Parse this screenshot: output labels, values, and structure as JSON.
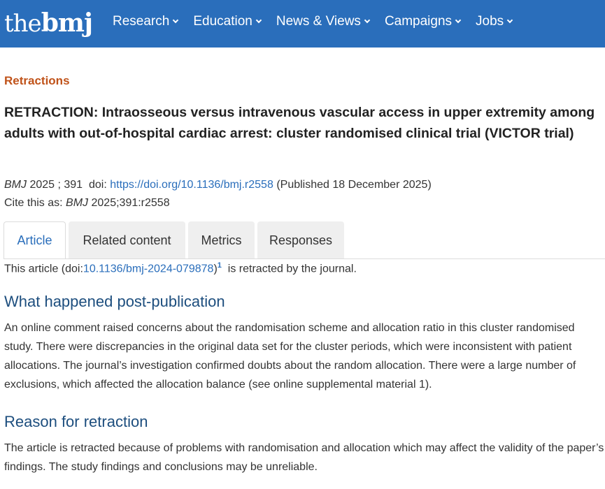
{
  "header": {
    "logo_the": "the",
    "logo_bmj": "bmj",
    "nav": [
      "Research",
      "Education",
      "News & Views",
      "Campaigns",
      "Jobs"
    ]
  },
  "section_label": "Retractions",
  "title": "RETRACTION: Intraosseous versus intravenous vascular access in upper extremity among adults with out-of-hospital cardiac arrest: cluster randomised clinical trial (VICTOR trial)",
  "citation": {
    "journal": "BMJ",
    "year_vol": "2025 ; 391",
    "doi_label": "doi:",
    "doi_url": "https://doi.org/10.1136/bmj.r2558",
    "published": "(Published 18 December 2025)",
    "cite_as_label": "Cite this as:",
    "cite_as_journal": "BMJ",
    "cite_as_ref": "2025;391:r2558"
  },
  "tabs": [
    "Article",
    "Related content",
    "Metrics",
    "Responses"
  ],
  "retract_note": {
    "prefix": "This article (doi:",
    "doi": "10.1136/bmj-2024-079878",
    "suffix_close": ")",
    "sup": "1",
    "suffix": " is retracted by the journal."
  },
  "section1": {
    "heading": "What happened post-publication",
    "body": "An online comment raised concerns about the randomisation scheme and allocation ratio in this cluster randomised study. There were discrepancies in the original data set for the cluster periods, which were inconsistent with patient allocations. The journal’s investigation confirmed doubts about the random allocation. There were a large number of exclusions, which affected the allocation balance (see online supplemental material 1)."
  },
  "section2": {
    "heading": "Reason for retraction",
    "body": "The article is retracted because of problems with randomisation and allocation which may affect the validity of the paper’s findings. The study findings and conclusions may be unreliable."
  },
  "colors": {
    "header_bg": "#2a6ebb",
    "section_label": "#c0531a",
    "heading": "#1d4e7e",
    "link": "#2a6ebb"
  }
}
